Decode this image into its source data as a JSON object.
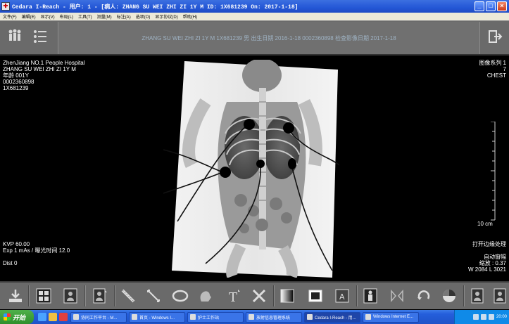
{
  "window": {
    "title": "Cedara I-Reach - 用户: 1 - [病人: ZHANG SU WEI ZHI ZI 1Y M ID: 1X681239 On: 2017-1-18]",
    "buttons": [
      "_",
      "□",
      "×"
    ]
  },
  "menu": [
    "文件(F)",
    "编辑(E)",
    "显示(V)",
    "布局(L)",
    "工具(T)",
    "测量(M)",
    "标注(A)",
    "选项(O)",
    "显示协议(D)",
    "帮助(H)"
  ],
  "patient_banner": "ZHANG SU WEI ZHI ZI 1Y M  1X681239  男 出生日期 2016-1-18  0002360898 检查影像日期 2017-1-18",
  "overlay_top_left": [
    "ZhenJiang NO.1 People Hospital",
    "ZHANG SU WEI ZHI ZI 1Y M",
    "年龄 001Y",
    "0002360898",
    "1X681239"
  ],
  "overlay_top_right": [
    "图像系列 1",
    "7",
    "CHEST"
  ],
  "overlay_bottom_left": [
    "KVP 60.00",
    "Exp 1 mAs / 曝光时间 12.0",
    "",
    "Dist 0"
  ],
  "overlay_bottom_right": {
    "edge": "打开边缘处理",
    "auto": "自动窗幅",
    "zoom": "缩放 : 0.37",
    "window": "W 2084 L 3021"
  },
  "ruler_label": "10 cm",
  "taskbar": {
    "start": "开始",
    "tasks": [
      "协同工作平台 - M...",
      "首页 - Windows I...",
      "护士工作站",
      "放射信息管理系统",
      "Cedara I-Reach - 用...",
      "Windows Internet E..."
    ],
    "clock": "20:00"
  },
  "icons": {
    "top": [
      "patients-icon",
      "worklist-icon",
      "exit-icon"
    ],
    "bottom": [
      "export-icon",
      "layout-grid-icon",
      "single-view-icon",
      "series-icon",
      "ruler-icon",
      "angle-icon",
      "lasso-icon",
      "magnify-icon",
      "text-icon",
      "delete-annotation-icon",
      "window-level-icon",
      "invert-icon",
      "annotation-toggle-icon",
      "person-icon",
      "flip-icon",
      "rotate-icon",
      "pie-icon",
      "prev-image-icon",
      "next-image-icon"
    ]
  }
}
